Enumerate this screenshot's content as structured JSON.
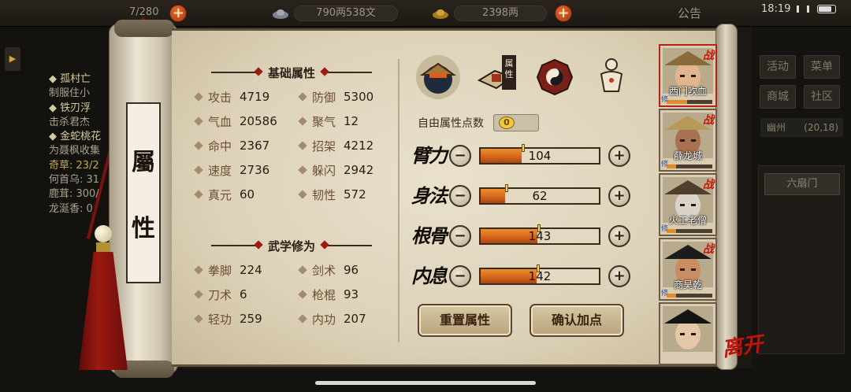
{
  "topbar": {
    "stamina": "7/280",
    "silver": "790两538文",
    "gold": "2398两",
    "notice": "公告",
    "time": "18:19"
  },
  "quests": [
    {
      "title": "◆ 孤村亡",
      "sub": "制服住小"
    },
    {
      "title": "◆ 铁刃浮",
      "sub": "击杀君杰"
    },
    {
      "title": "◆ 金蛇桃花",
      "sub": "为聂枫收集",
      "progress": [
        "奇草: 23/2",
        "何首乌: 31",
        "鹿茸: 300/",
        "龙涎香: 0"
      ]
    }
  ],
  "right_menu": {
    "buttons": [
      "活动",
      "菜单",
      "商城",
      "社区"
    ],
    "location": "幽州",
    "coord": "(20,18)",
    "map_entry": "六扇门"
  },
  "scroll": {
    "title_chars": [
      "屬",
      "性"
    ]
  },
  "basic": {
    "title": "基础属性",
    "stats": [
      {
        "name": "攻击",
        "value": "4719"
      },
      {
        "name": "防御",
        "value": "5300"
      },
      {
        "name": "气血",
        "value": "20586"
      },
      {
        "name": "聚气",
        "value": "12"
      },
      {
        "name": "命中",
        "value": "2367"
      },
      {
        "name": "招架",
        "value": "4212"
      },
      {
        "name": "速度",
        "value": "2736"
      },
      {
        "name": "躲闪",
        "value": "2942"
      },
      {
        "name": "真元",
        "value": "60"
      },
      {
        "name": "韧性",
        "value": "572"
      }
    ]
  },
  "martial": {
    "title": "武学修为",
    "stats": [
      {
        "name": "拳脚",
        "value": "224"
      },
      {
        "name": "剑术",
        "value": "96"
      },
      {
        "name": "刀术",
        "value": "6"
      },
      {
        "name": "枪棍",
        "value": "93"
      },
      {
        "name": "轻功",
        "value": "259"
      },
      {
        "name": "内功",
        "value": "207"
      }
    ]
  },
  "tabs": {
    "active_label": "属性"
  },
  "free_points": {
    "label": "自由属性点数",
    "value": "0"
  },
  "attributes": [
    {
      "name": "臂力",
      "value": 104,
      "text": "104"
    },
    {
      "name": "身法",
      "value": 62,
      "text": "62"
    },
    {
      "name": "根骨",
      "value": 143,
      "text": "143"
    },
    {
      "name": "内息",
      "value": 142,
      "text": "142"
    }
  ],
  "buttons": {
    "reset": "重置属性",
    "confirm": "确认加点",
    "minus": "−",
    "plus": "+"
  },
  "characters": [
    {
      "name": "西门吹血",
      "badge": "战",
      "tag": "修",
      "hp": 0.45,
      "active": true,
      "hat": "#8a6a3a",
      "face": "#e2b58e"
    },
    {
      "name": "薛龙城",
      "badge": "战",
      "tag": "修",
      "hp": 0.2,
      "active": false,
      "hat": "#b79a5a",
      "face": "#a87150"
    },
    {
      "name": "火工老僧",
      "badge": "战",
      "tag": "修",
      "hp": 0.2,
      "active": false,
      "hat": "#4e3e2a",
      "face": "#d9d4ca"
    },
    {
      "name": "商昊乾",
      "badge": "战",
      "tag": "修",
      "hp": 0.2,
      "active": false,
      "hat": "#1c1c1c",
      "face": "#c98d62"
    },
    {
      "name": "",
      "badge": "",
      "tag": "",
      "hp": 0,
      "active": false,
      "hat": "#141414",
      "face": "#e6c7a7"
    }
  ],
  "leave_label": "离开",
  "colors": {
    "accent_red": "#b32414",
    "bar_orange": "#d2621a",
    "parchment": "#e3d9c2"
  }
}
